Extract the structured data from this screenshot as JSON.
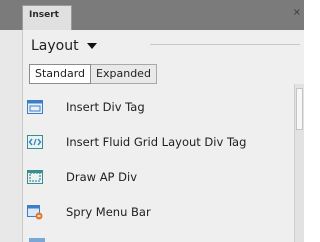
{
  "panel": {
    "tab_label": "Insert",
    "tab_close": "×",
    "category": "Layout",
    "modes": [
      "Standard",
      "Expanded"
    ],
    "active_mode": "Standard"
  },
  "items": [
    {
      "label": "Insert Div Tag",
      "icon": "div-tag-icon"
    },
    {
      "label": "Insert Fluid Grid Layout Div Tag",
      "icon": "fluid-grid-icon"
    },
    {
      "label": "Draw AP Div",
      "icon": "ap-div-icon"
    },
    {
      "label": "Spry Menu Bar",
      "icon": "spry-menu-bar-icon"
    }
  ],
  "colors": {
    "tabbar": "#7b7b7b",
    "panel_bg": "#efefef",
    "icon_blue": "#3d7fc4",
    "icon_teal": "#3a8f8a",
    "icon_orange": "#e07a2a"
  }
}
